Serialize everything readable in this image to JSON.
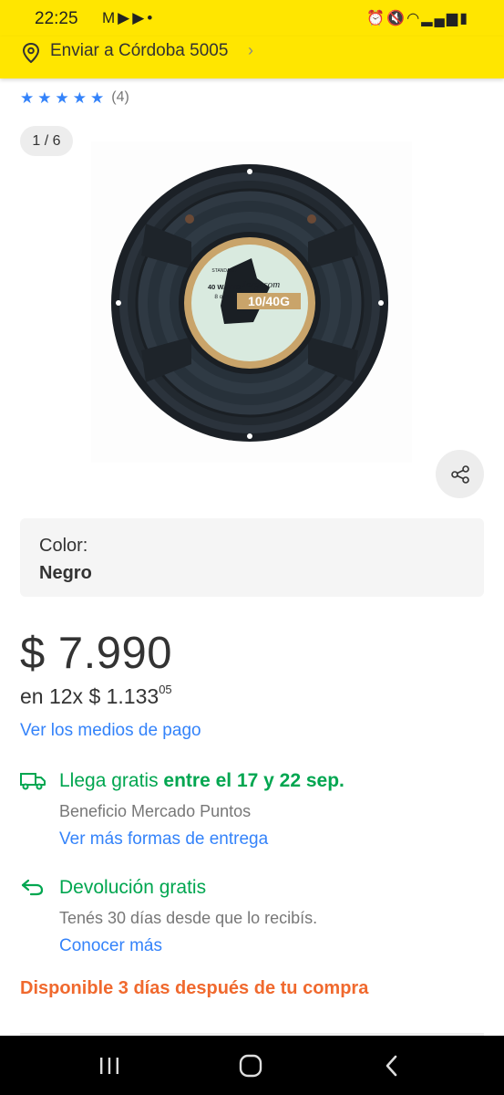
{
  "statusbar": {
    "time": "22:25",
    "notification_icons": [
      "gmail-icon",
      "youtube-icon",
      "youtube-icon"
    ],
    "system_icons": [
      "alarm-icon",
      "mute-icon",
      "wifi-icon",
      "signal-icon",
      "battery-icon"
    ]
  },
  "shipping_header": {
    "text": "Enviar a Córdoba 5005"
  },
  "rating": {
    "stars": 5,
    "count": "(4)"
  },
  "gallery": {
    "counter": "1 / 6",
    "image": {
      "power": "40 WATTS",
      "impedance": "8 ohms",
      "brand": "Jorgesom",
      "model": "10/40G",
      "line": "STANDARD"
    }
  },
  "variant": {
    "label": "Color:",
    "value": "Negro"
  },
  "price": {
    "main": "$ 7.990",
    "installments_prefix": "en 12x $ 1.133",
    "installments_cents": "05",
    "payment_link": "Ver los medios de pago"
  },
  "shipping": {
    "title_prefix": "Llega gratis ",
    "title_bold": "entre el 17 y 22 sep.",
    "benefit": "Beneficio Mercado Puntos",
    "more_link": "Ver más formas de entrega"
  },
  "returns": {
    "title": "Devolución gratis",
    "detail": "Tenés 30 días desde que lo recibís.",
    "link": "Conocer más"
  },
  "availability": "Disponible 3 días después de tu compra",
  "colors": {
    "brand_yellow": "#ffe600",
    "link_blue": "#3483fa",
    "success_green": "#00a650",
    "warning_orange": "#f0692e"
  }
}
